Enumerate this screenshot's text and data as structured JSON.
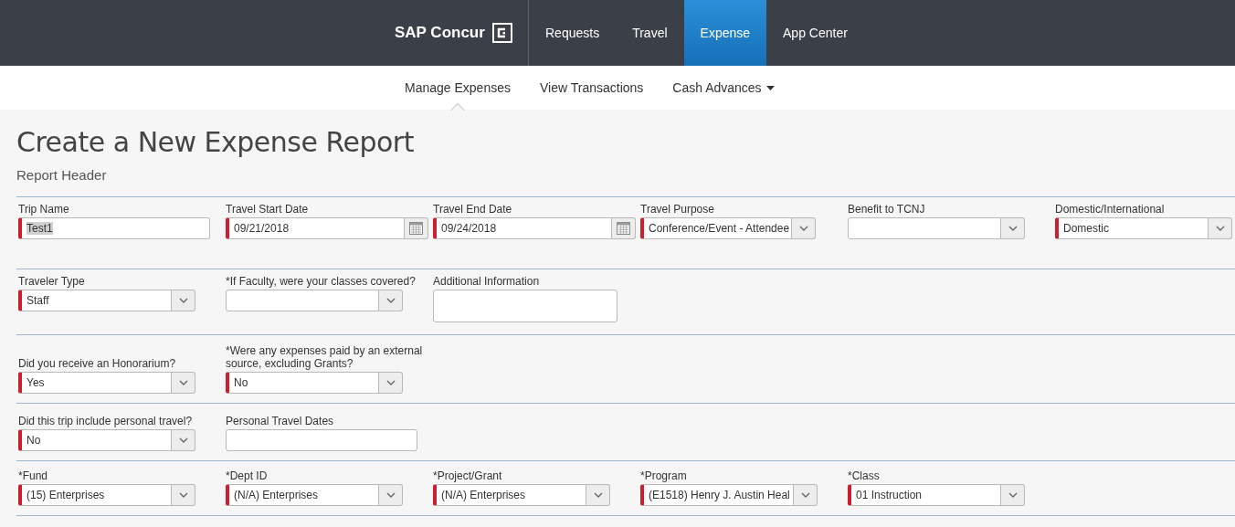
{
  "top_nav": {
    "logo": "SAP Concur",
    "tabs": [
      {
        "label": "Requests",
        "selected": false
      },
      {
        "label": "Travel",
        "selected": false
      },
      {
        "label": "Expense",
        "selected": true
      },
      {
        "label": "App Center",
        "selected": false
      }
    ]
  },
  "sub_nav": [
    {
      "label": "Manage Expenses",
      "selected": true,
      "dropdown": false
    },
    {
      "label": "View Transactions",
      "selected": false,
      "dropdown": false
    },
    {
      "label": "Cash Advances",
      "selected": false,
      "dropdown": true
    }
  ],
  "page": {
    "title": "Create a New Expense Report",
    "subtitle": "Report Header"
  },
  "sections": [
    {
      "fields": [
        {
          "label": "Trip Name",
          "kind": "text",
          "required": true,
          "value": "Test1",
          "highlighted": true
        },
        {
          "label": "Travel Start Date",
          "kind": "date",
          "required": true,
          "value": "09/21/2018"
        },
        {
          "label": "Travel End Date",
          "kind": "date",
          "required": true,
          "value": "09/24/2018"
        },
        {
          "label": "Travel Purpose",
          "kind": "select",
          "required": true,
          "value": "Conference/Event - Attendee"
        },
        {
          "label": "Benefit to TCNJ",
          "kind": "select",
          "required": false
        },
        {
          "label": "Domestic/International",
          "kind": "select",
          "required": true,
          "value": "Domestic"
        }
      ]
    },
    {
      "fields": [
        {
          "label": "Traveler Type",
          "kind": "select",
          "required": true,
          "value": "Staff"
        },
        {
          "label": "*If Faculty, were your classes covered?",
          "kind": "select",
          "required": false
        },
        {
          "label": "Additional Information",
          "kind": "textarea",
          "required": false
        }
      ]
    },
    {
      "fields": [
        {
          "label": "Did you receive an Honorarium?",
          "kind": "select",
          "required": true,
          "value": "Yes"
        },
        {
          "label": "*Were any expenses paid by an external source, excluding Grants?",
          "kind": "select",
          "required": true,
          "value": "No"
        }
      ]
    },
    {
      "fields": [
        {
          "label": "Did this trip include personal travel?",
          "kind": "select",
          "required": true,
          "value": "No"
        },
        {
          "label": "Personal Travel Dates",
          "kind": "text",
          "required": false
        }
      ]
    },
    {
      "fields": [
        {
          "label": "*Fund",
          "kind": "select",
          "required": true,
          "value": "(15) Enterprises"
        },
        {
          "label": "*Dept ID",
          "kind": "select",
          "required": true,
          "value": "(N/A) Enterprises"
        },
        {
          "label": "*Project/Grant",
          "kind": "select",
          "required": true,
          "value": "(N/A) Enterprises"
        },
        {
          "label": "*Program",
          "kind": "select",
          "required": true,
          "value": "(E1518) Henry J. Austin Heal"
        },
        {
          "label": "*Class",
          "kind": "select",
          "required": true,
          "value": "01 Instruction"
        }
      ]
    }
  ]
}
